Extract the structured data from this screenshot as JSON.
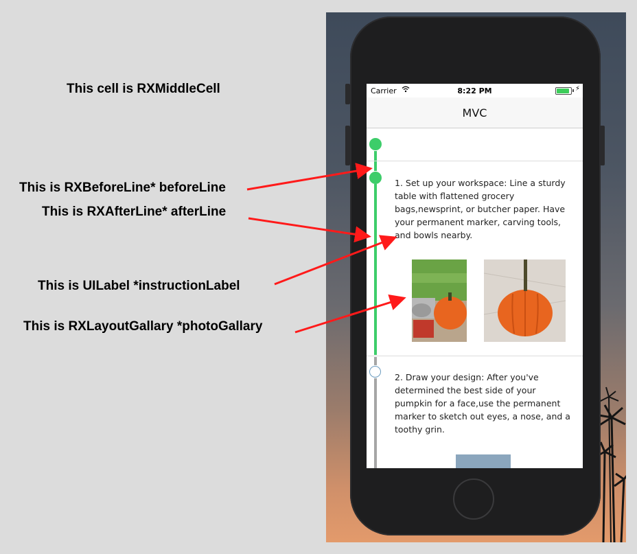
{
  "annotations": {
    "middle_cell": "This cell is RXMiddleCell",
    "before_line": "This is RXBeforeLine* beforeLine",
    "after_line": "This is RXAfterLine* afterLine",
    "instruction_label": "This is UILabel  *instructionLabel",
    "photo_gallery": "This is RXLayoutGallary *photoGallary"
  },
  "status_bar": {
    "carrier": "Carrier",
    "time": "8:22 PM",
    "wifi_icon": "wifi-icon",
    "battery_icon": "battery-icon",
    "battery_level": 1.0
  },
  "nav": {
    "title": "MVC"
  },
  "steps": [
    {
      "instruction": "1. Set up your workspace: Line a sturdy table with flattened grocery bags,newsprint, or butcher paper. Have your permanent marker, carving tools, and bowls nearby.",
      "state": "completed"
    },
    {
      "instruction": "2. Draw your design: After you've determined the best side of your pumpkin for a face,use the permanent marker to sketch out eyes, a nose, and a toothy grin.",
      "state": "pending"
    }
  ],
  "colors": {
    "active": "#3dcd6a",
    "inactive": "#a6a6a6",
    "pending_ring": "#6a9bbf",
    "arrow": "#ff1a1a",
    "pumpkin": "#e8651f"
  }
}
